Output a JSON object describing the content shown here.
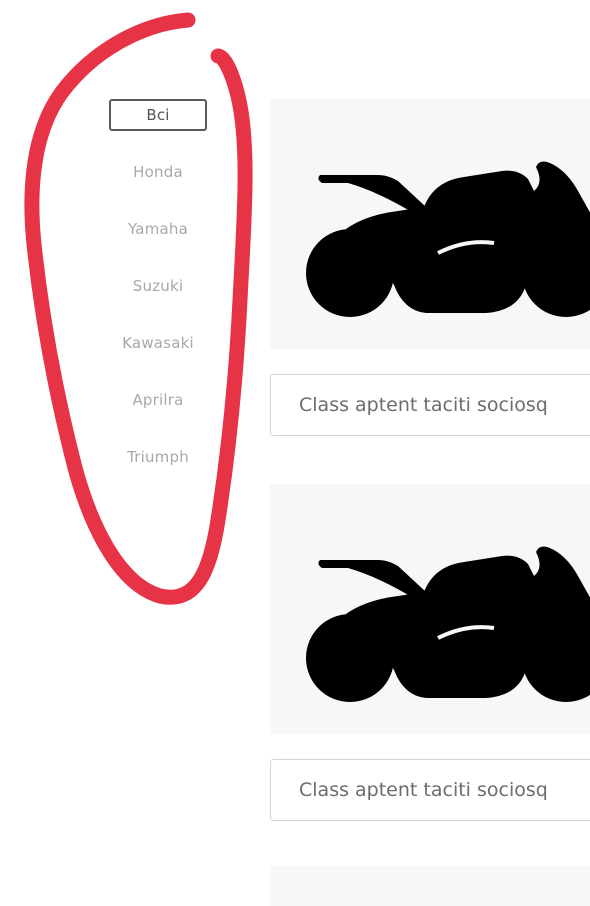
{
  "brand_filter": {
    "items": [
      {
        "label": "Bci",
        "active": true
      },
      {
        "label": "Honda",
        "active": false
      },
      {
        "label": "Yamaha",
        "active": false
      },
      {
        "label": "Suzuki",
        "active": false
      },
      {
        "label": "Kawasaki",
        "active": false
      },
      {
        "label": "Aprilra",
        "active": false
      },
      {
        "label": "Triumph",
        "active": false
      }
    ]
  },
  "products": [
    {
      "image_icon": "motorcycle-icon",
      "caption": "Class aptent taciti sociosq"
    },
    {
      "image_icon": "motorcycle-icon",
      "caption": "Class aptent taciti sociosq"
    }
  ],
  "colors": {
    "annotation_red": "#e63446",
    "active_border": "#5a5a5a",
    "inactive_text": "#a8a8a8",
    "card_background": "#f7f7f7",
    "icon_fill": "#000000"
  }
}
